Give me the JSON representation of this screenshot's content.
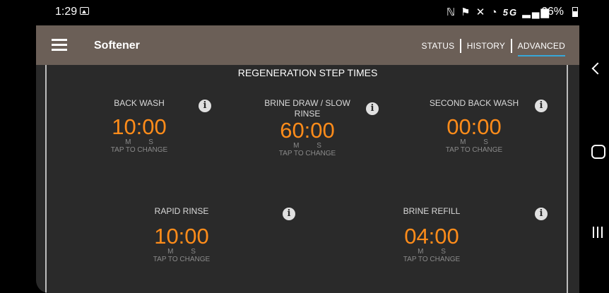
{
  "status_bar": {
    "time": "1:29",
    "icons_text": "ℕ ⚑ ✕ ◔ ",
    "network": "5G",
    "battery": "66%"
  },
  "app_bar": {
    "title": "Softener",
    "tabs": [
      {
        "label": "STATUS"
      },
      {
        "label": "HISTORY"
      },
      {
        "label": "ADVANCED"
      }
    ],
    "active_tab": "ADVANCED"
  },
  "section": {
    "title": "REGENERATION STEP TIMES"
  },
  "steps": [
    {
      "label": "BACK WASH",
      "value": "10:00",
      "m": "M",
      "s": "S",
      "hint": "TAP TO CHANGE"
    },
    {
      "label": "BRINE DRAW / SLOW RINSE",
      "value": "60:00",
      "m": "M",
      "s": "S",
      "hint": "TAP TO CHANGE"
    },
    {
      "label": "SECOND BACK WASH",
      "value": "00:00",
      "m": "M",
      "s": "S",
      "hint": "TAP TO CHANGE"
    },
    {
      "label": "RAPID RINSE",
      "value": "10:00",
      "m": "M",
      "s": "S",
      "hint": "TAP TO CHANGE"
    },
    {
      "label": "BRINE REFILL",
      "value": "04:00",
      "m": "M",
      "s": "S",
      "hint": "TAP TO CHANGE"
    }
  ],
  "info_icon_glyph": "i",
  "colors": {
    "accent": "#ff8c1a",
    "app_bar": "#6b5f57",
    "tab_underline": "#36a7d8",
    "background": "#2a2a2a"
  }
}
